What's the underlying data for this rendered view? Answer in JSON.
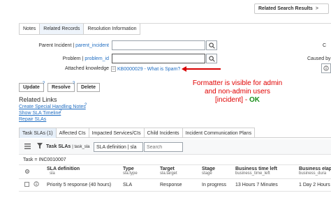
{
  "header": {
    "related_search_label": "Related Search Results",
    "chevron": ">"
  },
  "form_tabs": [
    "Notes",
    "Related Records",
    "Resolution Information"
  ],
  "fields": {
    "parent_incident": {
      "label": "Parent Incident",
      "sep": " | ",
      "tag": "parent_incident",
      "value": ""
    },
    "problem": {
      "label": "Problem",
      "sep": " | ",
      "tag": "problem_id",
      "value": ""
    },
    "attached_knowledge": {
      "label": "Attached knowledge",
      "link": "KB0000029 - What is Spam?"
    },
    "right_labels": {
      "caused_by": "Caused by",
      "c_partial": "C"
    }
  },
  "annotation": {
    "line1": "Formatter is visible for admin",
    "line2": "and non-admin users",
    "line3": "[incident] -",
    "ok": "OK"
  },
  "actions": [
    "Update",
    "Resolve",
    "Delete"
  ],
  "related_links": {
    "title": "Related Links",
    "links": [
      "Create Special Handling Notes",
      "Show SLA Timeline",
      "Repair SLAs"
    ]
  },
  "related_list_tabs": [
    "Task SLAs (1)",
    "Affected CIs",
    "Impacted Services/CIs",
    "Child Incidents",
    "Incident Communication Plans"
  ],
  "toolbar": {
    "list_title": "Task SLAs",
    "list_table": "| task_sla",
    "filter_field": "SLA definition | sla",
    "search_placeholder": "Search"
  },
  "breadcrumb": "Task = INC0010007",
  "table": {
    "columns": [
      {
        "label": "SLA definition",
        "sub": "sla"
      },
      {
        "label": "Type",
        "sub": "sla.type"
      },
      {
        "label": "Target",
        "sub": "sla.target"
      },
      {
        "label": "Stage",
        "sub": "stage"
      },
      {
        "label": "Business time left",
        "sub": "business_time_left"
      },
      {
        "label": "Business elaps",
        "sub": "business_dura"
      }
    ],
    "rows": [
      {
        "sla": "Priority 5 response (40 hours)",
        "type": "SLA",
        "target": "Response",
        "stage": "In progress",
        "left": "13 Hours 7 Minutes",
        "elapsed": "1 Day 2 Hours"
      }
    ]
  }
}
